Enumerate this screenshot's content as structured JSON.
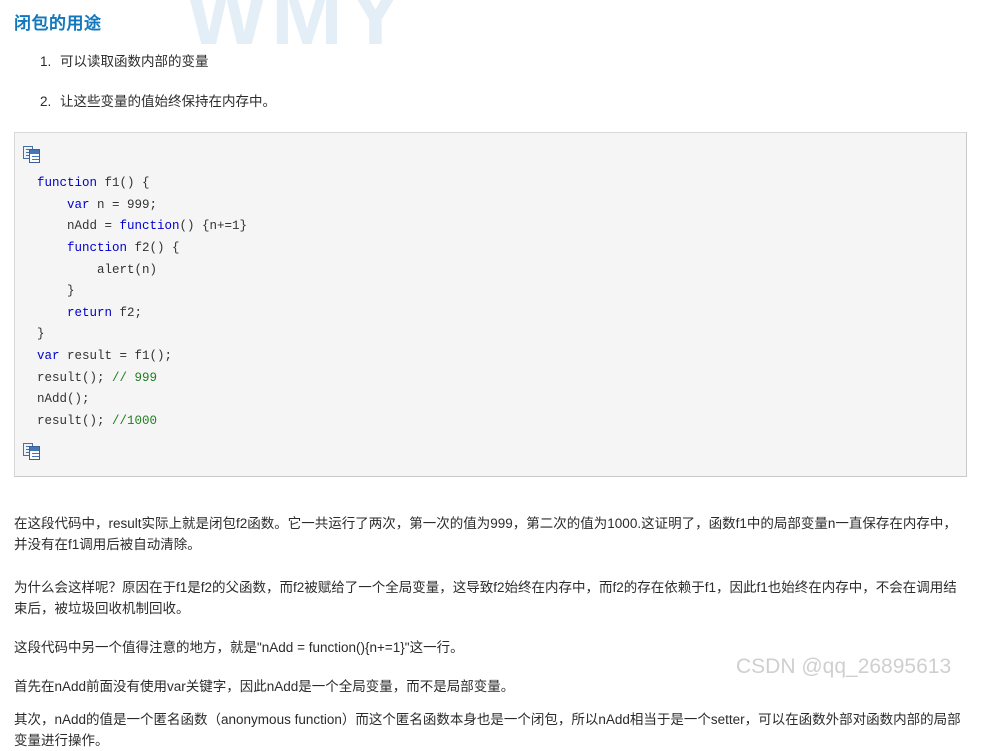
{
  "watermarks": {
    "top": "WMY",
    "bottom": "CSDN @qq_26895613"
  },
  "title": "闭包的用途",
  "list": {
    "items": [
      {
        "num": "1.",
        "text": "可以读取函数内部的变量"
      },
      {
        "num": "2.",
        "text": "让这些变量的值始终保持在内存中。"
      }
    ]
  },
  "code_block": {
    "copy_icon_top": "copy-icon",
    "copy_icon_bottom": "copy-icon",
    "language": "javascript",
    "lines": [
      "function f1() {",
      "    var n = 999;",
      "    nAdd = function() {n+=1}",
      "    function f2() {",
      "        alert(n)",
      "    }",
      "    return f2;",
      "}",
      "var result = f1();",
      "result(); // 999",
      "nAdd();",
      "result(); //1000"
    ],
    "code_html": "<span class=\"kw\">function</span> f1() {\n    <span class=\"kw\">var</span> n = 999;\n    nAdd = <span class=\"kw\">function</span>() {n+=1}\n    <span class=\"kw\">function</span> f2() {\n        alert(n)\n    }\n    <span class=\"kw\">return</span> f2;\n}\n<span class=\"kw\">var</span> result = f1();\nresult(); <span class=\"cmt\">// 999</span>\nnAdd();\nresult(); <span class=\"cmt\">//1000</span>"
  },
  "paragraphs": {
    "p1": "在这段代码中，result实际上就是闭包f2函数。它一共运行了两次，第一次的值为999，第二次的值为1000.这证明了，函数f1中的局部变量n一直保存在内存中，并没有在f1调用后被自动清除。",
    "p2": "为什么会这样呢？原因在于f1是f2的父函数，而f2被赋给了一个全局变量，这导致f2始终在内存中，而f2的存在依赖于f1，因此f1也始终在内存中，不会在调用结束后，被垃圾回收机制回收。",
    "p3": "这段代码中另一个值得注意的地方，就是\"nAdd = function(){n+=1}\"这一行。",
    "p4": "首先在nAdd前面没有使用var关键字，因此nAdd是一个全局变量，而不是局部变量。",
    "p5": "其次，nAdd的值是一个匿名函数（anonymous function）而这个匿名函数本身也是一个闭包，所以nAdd相当于是一个setter，可以在函数外部对函数内部的局部变量进行操作。"
  },
  "colors": {
    "title": "#1278bd",
    "code_keyword": "#0000cd",
    "code_comment": "#1f7f1f",
    "code_bg": "#f5f5f5",
    "watermark_top": "#e3eef6"
  }
}
